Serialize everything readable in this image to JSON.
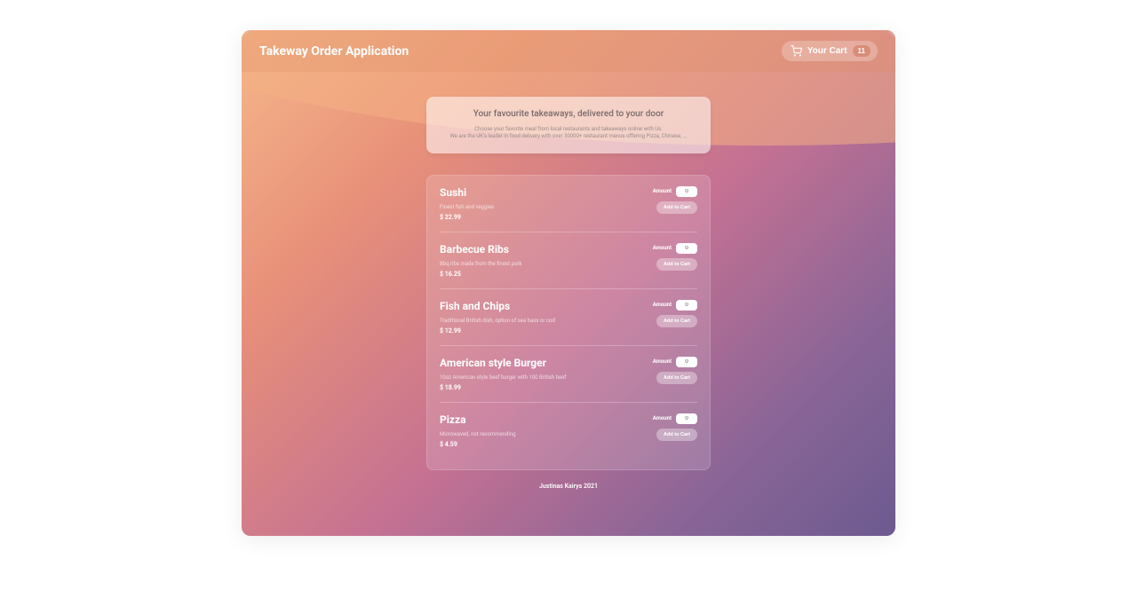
{
  "header": {
    "title": "Takeway Order Application",
    "cart_label": "Your Cart",
    "cart_count": "11"
  },
  "hero": {
    "title": "Your favourite takeaways, delivered to your door",
    "subtitle_line1": "Choose your favorite meal from local restaurants and takeaways online with Us.",
    "subtitle_line2": "We are the UK's leader in food delivery with over 30000+ restaurant menus offering Pizza, Chinese, ..."
  },
  "amount_label": "Amount",
  "add_label": "Add to Cart",
  "currency_prefix": "$ ",
  "meals": [
    {
      "name": "Sushi",
      "desc": "Finest fish and veggies",
      "price": "22.99",
      "amount": "0"
    },
    {
      "name": "Barbecue Ribs",
      "desc": "Bbq ribs made from the finest pork",
      "price": "16.25",
      "amount": "0"
    },
    {
      "name": "Fish and Chips",
      "desc": "Traditional British dish, option of sea bass or cod",
      "price": "12.99",
      "amount": "0"
    },
    {
      "name": "American style Burger",
      "desc": "10oz American style beef burger with 100 British beef",
      "price": "18.99",
      "amount": "0"
    },
    {
      "name": "Pizza",
      "desc": "Microwaved, not recommending",
      "price": "4.59",
      "amount": "0"
    }
  ],
  "footer": "Justinas Kairys 2021"
}
